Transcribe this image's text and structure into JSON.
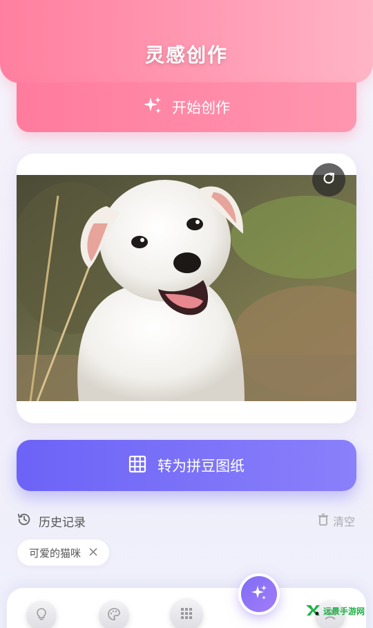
{
  "header": {
    "title": "灵感创作"
  },
  "start_button": {
    "label": "开始创作",
    "icon": "sparkles-icon"
  },
  "image_card": {
    "photo_alt": "白色小狗",
    "refresh_icon": "refresh-icon"
  },
  "convert_button": {
    "label": "转为拼豆图纸",
    "icon": "grid-icon"
  },
  "history": {
    "title": "历史记录",
    "clear_label": "清空",
    "chips": [
      {
        "label": "可爱的猫咪"
      }
    ]
  },
  "bottom_nav": {
    "items": [
      {
        "icon": "lightbulb-icon"
      },
      {
        "icon": "palette-icon"
      },
      {
        "icon": "grid-icon"
      },
      {
        "icon": "sparkles-icon"
      },
      {
        "icon": "user-icon"
      }
    ]
  },
  "watermark": {
    "text": "远景手游网"
  },
  "colors": {
    "pink": "#ff7f9f",
    "purple": "#6c63f7",
    "text": "#555555"
  }
}
